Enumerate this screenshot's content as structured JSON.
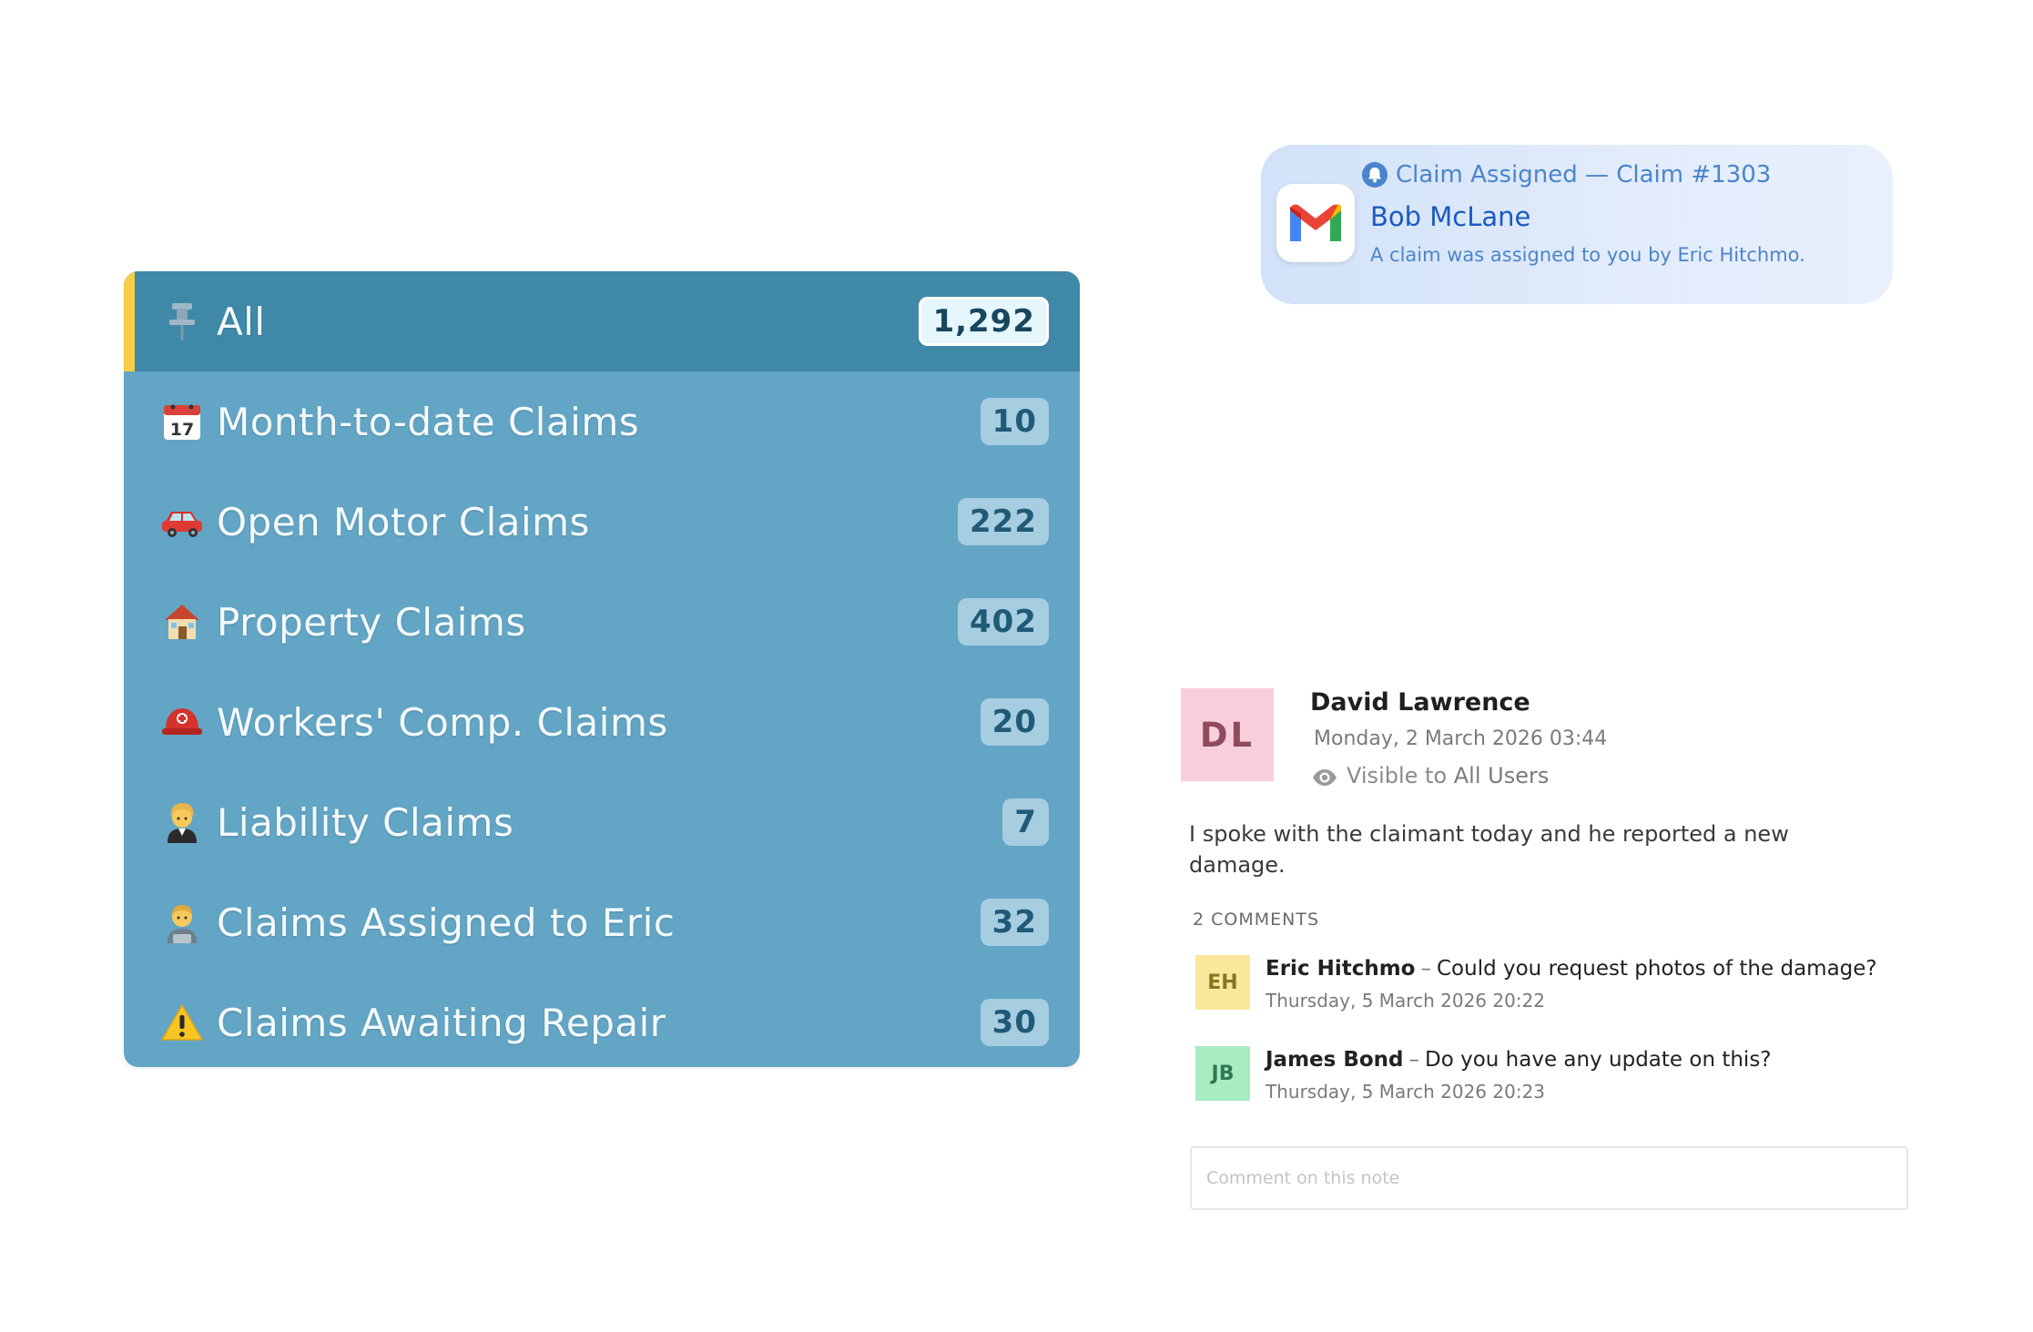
{
  "claims_list": {
    "items": [
      {
        "icon": "pushpin-icon",
        "label": "All",
        "count": "1,292",
        "active": true
      },
      {
        "icon": "calendar-icon",
        "label": "Month-to-date Claims",
        "count": "10"
      },
      {
        "icon": "car-icon",
        "label": "Open Motor Claims",
        "count": "222"
      },
      {
        "icon": "house-icon",
        "label": "Property Claims",
        "count": "402"
      },
      {
        "icon": "rescue-helmet-icon",
        "label": "Workers' Comp. Claims",
        "count": "20"
      },
      {
        "icon": "judge-icon",
        "label": "Liability Claims",
        "count": "7"
      },
      {
        "icon": "office-worker-icon",
        "label": "Claims Assigned to Eric",
        "count": "32"
      },
      {
        "icon": "warning-icon",
        "label": "Claims Awaiting Repair",
        "count": "30"
      }
    ]
  },
  "notification": {
    "header": "Claim Assigned — Claim #1303",
    "title": "Bob McLane",
    "body": "A claim was assigned to you by Eric Hitchmo.",
    "app_icon": "gmail-icon"
  },
  "note": {
    "avatar_initials": "DL",
    "author": "David Lawrence",
    "date": "Monday, 2 March 2026 03:44",
    "visibility_prefix": "Visible to",
    "visibility_target": "All Users",
    "text": "I spoke with the claimant today and he reported a new damage.",
    "comments_heading": "2 COMMENTS",
    "comments": [
      {
        "initials": "EH",
        "author": "Eric Hitchmo",
        "separator": "–",
        "text": "Could you request photos of the damage?",
        "date": "Thursday, 5 March 2026 20:22"
      },
      {
        "initials": "JB",
        "author": "James Bond",
        "separator": "–",
        "text": "Do you have any update on this?",
        "date": "Thursday, 5 March 2026 20:23"
      }
    ],
    "comment_placeholder": "Comment on this note"
  },
  "colors": {
    "panel_bg": "#63a5c5",
    "active_row_bg": "#3f88a8",
    "active_accent": "#f4cf47",
    "notification_text": "#1a5bc0",
    "eh_avatar": "#f9e79a",
    "jb_avatar": "#a8ecc4",
    "dl_avatar": "#f9cedc"
  }
}
